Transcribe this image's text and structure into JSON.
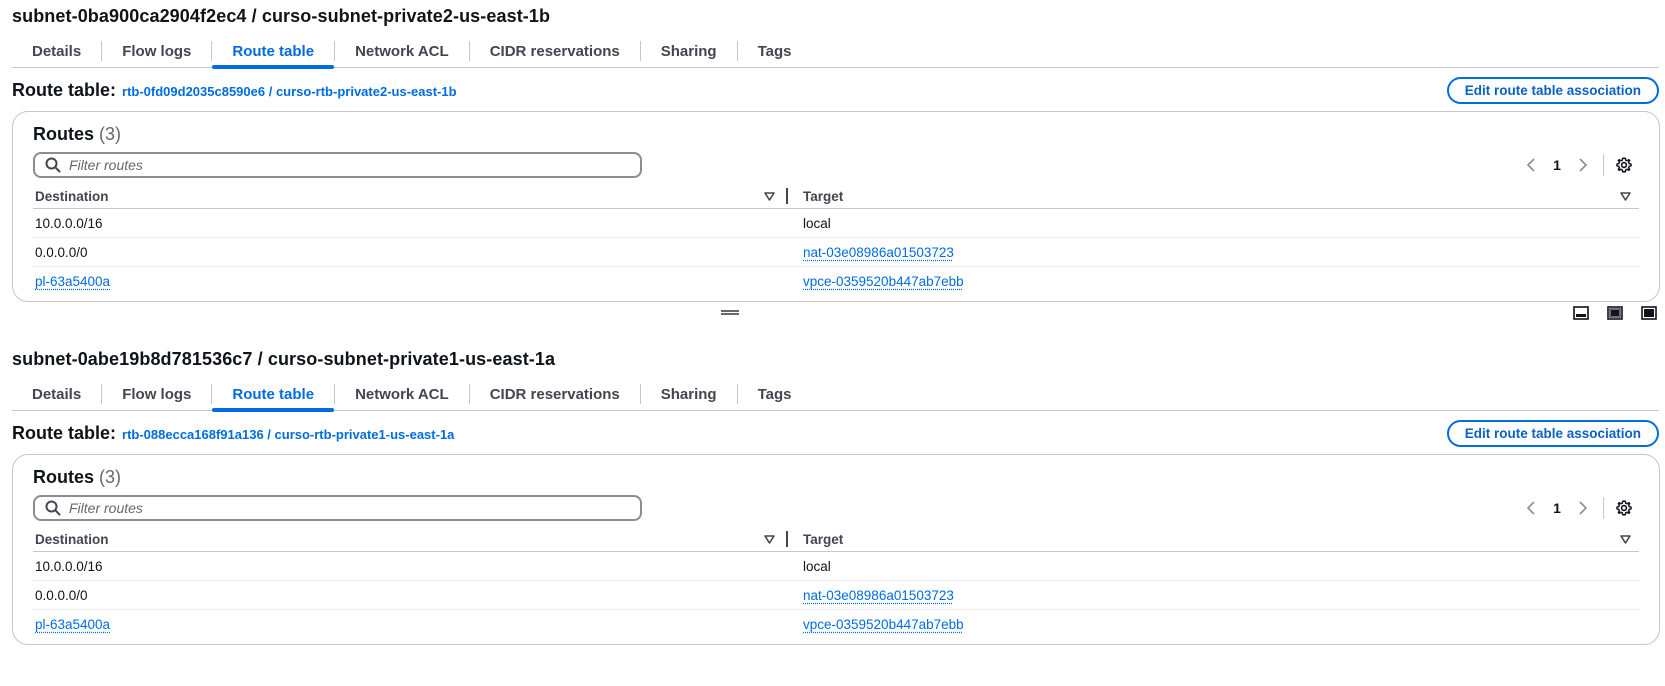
{
  "panels": [
    {
      "subnet_title": "subnet-0ba900ca2904f2ec4 / curso-subnet-private2-us-east-1b",
      "tabs": [
        "Details",
        "Flow logs",
        "Route table",
        "Network ACL",
        "CIDR reservations",
        "Sharing",
        "Tags"
      ],
      "active_tab": "Route table",
      "route_table_label": "Route table:",
      "route_table_link": "rtb-0fd09d2035c8590e6 / curso-rtb-private2-us-east-1b",
      "edit_button": "Edit route table association",
      "routes_heading": "Routes",
      "routes_count": "(3)",
      "filter_placeholder": "Filter routes",
      "page_number": "1",
      "columns": {
        "destination": "Destination",
        "target": "Target"
      },
      "rows": [
        {
          "destination": "10.0.0.0/16",
          "destination_link": false,
          "target": "local",
          "target_link": false
        },
        {
          "destination": "0.0.0.0/0",
          "destination_link": false,
          "target": "nat-03e08986a01503723",
          "target_link": true
        },
        {
          "destination": "pl-63a5400a",
          "destination_link": true,
          "target": "vpce-0359520b447ab7ebb",
          "target_link": true
        }
      ]
    },
    {
      "subnet_title": "subnet-0abe19b8d781536c7 / curso-subnet-private1-us-east-1a",
      "tabs": [
        "Details",
        "Flow logs",
        "Route table",
        "Network ACL",
        "CIDR reservations",
        "Sharing",
        "Tags"
      ],
      "active_tab": "Route table",
      "route_table_label": "Route table:",
      "route_table_link": "rtb-088ecca168f91a136 / curso-rtb-private1-us-east-1a",
      "edit_button": "Edit route table association",
      "routes_heading": "Routes",
      "routes_count": "(3)",
      "filter_placeholder": "Filter routes",
      "page_number": "1",
      "columns": {
        "destination": "Destination",
        "target": "Target"
      },
      "rows": [
        {
          "destination": "10.0.0.0/16",
          "destination_link": false,
          "target": "local",
          "target_link": false
        },
        {
          "destination": "0.0.0.0/0",
          "destination_link": false,
          "target": "nat-03e08986a01503723",
          "target_link": true
        },
        {
          "destination": "pl-63a5400a",
          "destination_link": true,
          "target": "vpce-0359520b447ab7ebb",
          "target_link": true
        }
      ]
    }
  ],
  "icons": {
    "filter": "search-icon",
    "prev_page": "chevron-left-icon",
    "next_page": "chevron-right-icon",
    "preferences": "gear-icon",
    "sort": "caret-down-icon",
    "splitter": "drag-handle-icon",
    "layouts": [
      "split-bottom-icon",
      "split-side-icon",
      "full-screen-icon"
    ]
  },
  "colors": {
    "link": "#006ce0",
    "text": "#0f141a",
    "border": "#c6c6cd",
    "muted": "#656871"
  }
}
